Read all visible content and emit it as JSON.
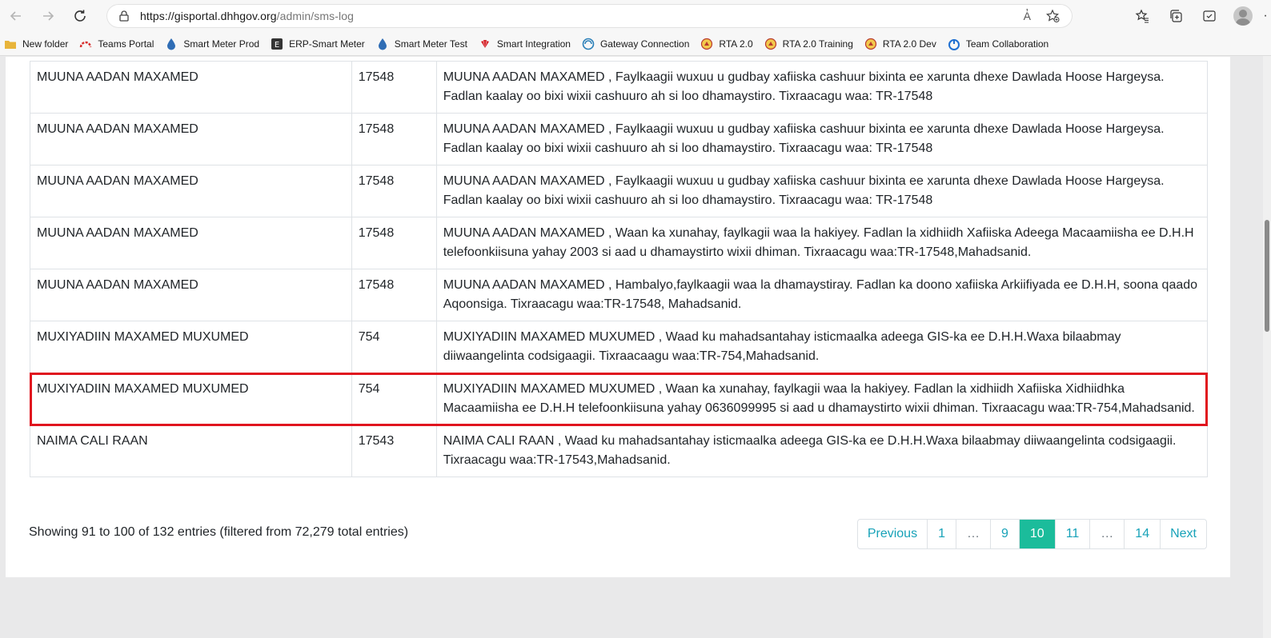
{
  "browser": {
    "url_host": "https://gisportal.dhhgov.org",
    "url_path": "/admin/sms-log",
    "read_aloud": "A̓",
    "more": "·"
  },
  "bookmarks": [
    {
      "label": "New folder",
      "icon": "folder-icon",
      "color": "#e8b43a"
    },
    {
      "label": "Teams Portal",
      "icon": "teams-portal-icon",
      "color": "#d8302f"
    },
    {
      "label": "Smart Meter Prod",
      "icon": "droplet-icon",
      "color": "#2f6db5"
    },
    {
      "label": "ERP-Smart Meter",
      "icon": "erp-icon",
      "color": "#333333"
    },
    {
      "label": "Smart Meter Test",
      "icon": "droplet-icon",
      "color": "#2f6db5"
    },
    {
      "label": "Smart Integration",
      "icon": "huawei-icon",
      "color": "#d7262c"
    },
    {
      "label": "Gateway Connection",
      "icon": "gateway-icon",
      "color": "#2a7fb8"
    },
    {
      "label": "RTA 2.0",
      "icon": "rta-icon",
      "color": "#b9392f"
    },
    {
      "label": "RTA 2.0 Training",
      "icon": "rta-icon",
      "color": "#b9392f"
    },
    {
      "label": "RTA 2.0 Dev",
      "icon": "rta-icon",
      "color": "#b9392f"
    },
    {
      "label": "Team Collaboration",
      "icon": "power-icon",
      "color": "#1f6fd1"
    }
  ],
  "table": {
    "rows": [
      {
        "name": "MUUNA AADAN MAXAMED",
        "ref": "17548",
        "message": "MUUNA AADAN MAXAMED , Faylkaagii wuxuu u gudbay xafiiska cashuur bixinta ee xarunta dhexe Dawlada Hoose Hargeysa. Fadlan kaalay oo bixi wixii cashuuro ah si loo dhamaystiro. Tixraacagu waa: TR-17548"
      },
      {
        "name": "MUUNA AADAN MAXAMED",
        "ref": "17548",
        "message": "MUUNA AADAN MAXAMED , Faylkaagii wuxuu u gudbay xafiiska cashuur bixinta ee xarunta dhexe Dawlada Hoose Hargeysa. Fadlan kaalay oo bixi wixii cashuuro ah si loo dhamaystiro. Tixraacagu waa: TR-17548"
      },
      {
        "name": "MUUNA AADAN MAXAMED",
        "ref": "17548",
        "message": "MUUNA AADAN MAXAMED , Faylkaagii wuxuu u gudbay xafiiska cashuur bixinta ee xarunta dhexe Dawlada Hoose Hargeysa. Fadlan kaalay oo bixi wixii cashuuro ah si loo dhamaystiro. Tixraacagu waa: TR-17548"
      },
      {
        "name": "MUUNA AADAN MAXAMED",
        "ref": "17548",
        "message": "MUUNA AADAN MAXAMED , Waan ka xunahay, faylkagii waa la hakiyey. Fadlan la xidhiidh Xafiiska Adeega Macaamiisha ee D.H.H telefoonkiisuna yahay 2003 si aad u dhamaystirto wixii dhiman. Tixraacagu waa:TR-17548,Mahadsanid."
      },
      {
        "name": "MUUNA AADAN MAXAMED",
        "ref": "17548",
        "message": "MUUNA AADAN MAXAMED , Hambalyo,faylkaagii waa la dhamaystiray. Fadlan ka doono xafiiska Arkiifiyada ee D.H.H, soona qaado Aqoonsiga. Tixraacagu waa:TR-17548, Mahadsanid."
      },
      {
        "name": "MUXIYADIIN MAXAMED MUXUMED",
        "ref": "754",
        "message": "MUXIYADIIN MAXAMED MUXUMED , Waad ku mahadsantahay isticmaalka adeega GIS-ka ee D.H.H.Waxa bilaabmay diiwaangelinta codsigaagii. Tixraacaagu waa:TR-754,Mahadsanid."
      },
      {
        "name": "MUXIYADIIN MAXAMED MUXUMED",
        "ref": "754",
        "message": "MUXIYADIIN MAXAMED MUXUMED , Waan ka xunahay, faylkagii waa la hakiyey. Fadlan la xidhiidh Xafiiska Xidhiidhka Macaamiisha ee D.H.H telefoonkiisuna yahay 0636099995 si aad u dhamaystirto wixii dhiman. Tixraacagu waa:TR-754,Mahadsanid."
      },
      {
        "name": "NAIMA CALI RAAN",
        "ref": "17543",
        "message": "NAIMA CALI RAAN , Waad ku mahadsantahay isticmaalka adeega GIS-ka ee D.H.H.Waxa bilaabmay diiwaangelinta codsigaagii. Tixraacagu waa:TR-17543,Mahadsanid."
      }
    ],
    "highlight_color": "#e0141e"
  },
  "footer": {
    "info": "Showing 91 to 100 of 132 entries (filtered from 72,279 total entries)"
  },
  "pagination": {
    "previous": "Previous",
    "pages": [
      "1",
      "…",
      "9",
      "10",
      "11",
      "…",
      "14"
    ],
    "active": "10",
    "next": "Next",
    "active_color": "#1bbc9b",
    "link_color": "#17a2b8"
  }
}
